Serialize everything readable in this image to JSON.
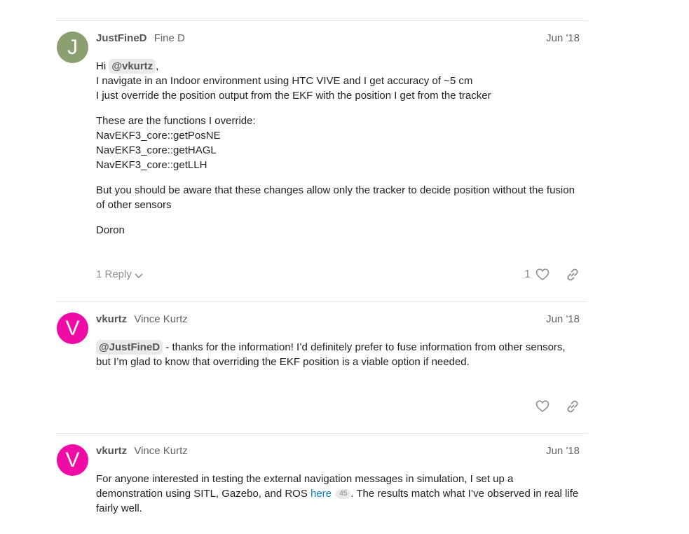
{
  "colors": {
    "avatar_j": "#8b9f6f",
    "avatar_v": "#ef0ba5",
    "link": "#0a82c8",
    "muted": "#909090"
  },
  "posts": [
    {
      "avatar_letter": "J",
      "username": "JustFineD",
      "fullname": "Fine D",
      "date": "Jun '18",
      "greeting": "Hi ",
      "mention": "@vkurtz",
      "greeting_tail": ",",
      "lines1": [
        "I navigate in an Indoor environment using HTC VIVE and I get accuracy of ~5 cm",
        "I just override the position output from the EKF with the position I get from the tracker"
      ],
      "functions_intro": "These are the functions I override:",
      "functions": [
        "NavEKF3_core::getPosNE",
        "NavEKF3_core::getHAGL",
        "NavEKF3_core::getLLH"
      ],
      "warning": "But you should be aware that these changes allow only the tracker to decide position without the fusion of other sensors",
      "signature": "Doron",
      "replies_label": "1 Reply",
      "like_count": "1",
      "like_icon": "heart-icon",
      "link_icon": "link-icon"
    },
    {
      "avatar_letter": "V",
      "username": "vkurtz",
      "fullname": "Vince Kurtz",
      "date": "Jun '18",
      "mention": "@JustFineD",
      "text": " - thanks for the information! I’d definitely prefer to fuse information from other sensors, but I’m glad to know that overriding the EKF position is a viable option if needed."
    },
    {
      "avatar_letter": "V",
      "username": "vkurtz",
      "fullname": "Vince Kurtz",
      "date": "Jun '18",
      "text_before": "For anyone interested in testing the external navigation messages in simulation, I set up a demonstration using SITL, Gazebo, and ROS ",
      "link_text": "here",
      "link_clicks": "45",
      "text_after": ". The results match what I’ve observed in real life fairly well."
    }
  ]
}
